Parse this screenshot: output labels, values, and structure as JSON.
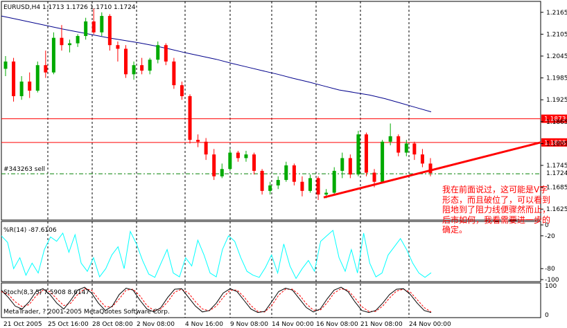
{
  "chart_data": {
    "type": "candlestick",
    "symbol_header": "EURUSD,H4  1.1713 1.1726 1.1710 1.1724",
    "price_axis": {
      "ylim": [
        1.1595,
        1.2195
      ],
      "ticks": [
        "1.2165",
        "1.2105",
        "1.2045",
        "1.1985",
        "1.1925",
        "1.1865",
        "1.1805",
        "1.1745",
        "1.1685",
        "1.1625"
      ]
    },
    "x_tick_labels": [
      "21 Oct 2005",
      "25 Oct 16:00",
      "28 Oct 08:00",
      "2 Nov 08:00",
      "4 Nov 16:00",
      "9 Nov 08:00",
      "14 Nov 00:00",
      "16 Nov 08:00",
      "21 Nov 08:00",
      "24 Nov 00:00"
    ],
    "horizontal_lines": [
      {
        "price": 1.1873,
        "label": "1.1873",
        "color": "#ff0000"
      },
      {
        "price": 1.1808,
        "label": "1.1808",
        "color": "#ff0000"
      }
    ],
    "order_line": {
      "label": "#343263 sell",
      "price": 1.1722,
      "color": "#008000"
    },
    "current_price": {
      "label": "1.1724",
      "price": 1.1724
    },
    "trendline": {
      "from_price": 1.1657,
      "to_price": 1.1808,
      "color": "#ff0000"
    },
    "moving_average": {
      "color": "#00008b",
      "values": [
        1.2155,
        1.2146,
        1.2137,
        1.2128,
        1.2119,
        1.2111,
        1.2103,
        1.2095,
        1.2088,
        1.2081,
        1.2073,
        1.2064,
        1.2054,
        1.2045,
        1.2036,
        1.2025,
        1.2015,
        1.2005,
        1.1995,
        1.1984,
        1.1974,
        1.1963,
        1.1952,
        1.1945,
        1.1938,
        1.1928,
        1.1916,
        1.1904,
        1.1892
      ]
    },
    "candles": [
      {
        "o": 1.201,
        "h": 1.2045,
        "l": 1.199,
        "c": 1.203
      },
      {
        "o": 1.203,
        "h": 1.204,
        "l": 1.192,
        "c": 1.1935
      },
      {
        "o": 1.1935,
        "h": 1.199,
        "l": 1.1925,
        "c": 1.1975
      },
      {
        "o": 1.1975,
        "h": 1.2,
        "l": 1.193,
        "c": 1.195
      },
      {
        "o": 1.195,
        "h": 1.203,
        "l": 1.1945,
        "c": 1.202
      },
      {
        "o": 1.202,
        "h": 1.206,
        "l": 1.1985,
        "c": 1.2
      },
      {
        "o": 1.2,
        "h": 1.211,
        "l": 1.1995,
        "c": 1.2095
      },
      {
        "o": 1.2095,
        "h": 1.213,
        "l": 1.206,
        "c": 1.2075
      },
      {
        "o": 1.2075,
        "h": 1.209,
        "l": 1.2055,
        "c": 1.208
      },
      {
        "o": 1.208,
        "h": 1.2105,
        "l": 1.207,
        "c": 1.21
      },
      {
        "o": 1.21,
        "h": 1.215,
        "l": 1.209,
        "c": 1.214
      },
      {
        "o": 1.214,
        "h": 1.2175,
        "l": 1.2105,
        "c": 1.211
      },
      {
        "o": 1.211,
        "h": 1.2165,
        "l": 1.21,
        "c": 1.2155
      },
      {
        "o": 1.2155,
        "h": 1.216,
        "l": 1.206,
        "c": 1.2075
      },
      {
        "o": 1.2075,
        "h": 1.2085,
        "l": 1.203,
        "c": 1.2065
      },
      {
        "o": 1.2065,
        "h": 1.2075,
        "l": 1.1985,
        "c": 1.1995
      },
      {
        "o": 1.1995,
        "h": 1.203,
        "l": 1.198,
        "c": 1.202
      },
      {
        "o": 1.202,
        "h": 1.204,
        "l": 1.1995,
        "c": 1.2005
      },
      {
        "o": 1.2005,
        "h": 1.204,
        "l": 1.1995,
        "c": 1.2035
      },
      {
        "o": 1.2035,
        "h": 1.2085,
        "l": 1.2025,
        "c": 1.2075
      },
      {
        "o": 1.2075,
        "h": 1.208,
        "l": 1.202,
        "c": 1.203
      },
      {
        "o": 1.203,
        "h": 1.204,
        "l": 1.1955,
        "c": 1.1965
      },
      {
        "o": 1.1965,
        "h": 1.1975,
        "l": 1.1925,
        "c": 1.1935
      },
      {
        "o": 1.1935,
        "h": 1.194,
        "l": 1.1805,
        "c": 1.1815
      },
      {
        "o": 1.1815,
        "h": 1.183,
        "l": 1.1795,
        "c": 1.181
      },
      {
        "o": 1.181,
        "h": 1.182,
        "l": 1.176,
        "c": 1.1775
      },
      {
        "o": 1.1775,
        "h": 1.179,
        "l": 1.1705,
        "c": 1.1715
      },
      {
        "o": 1.1715,
        "h": 1.175,
        "l": 1.171,
        "c": 1.1735
      },
      {
        "o": 1.1735,
        "h": 1.179,
        "l": 1.173,
        "c": 1.178
      },
      {
        "o": 1.178,
        "h": 1.1785,
        "l": 1.1755,
        "c": 1.1765
      },
      {
        "o": 1.1765,
        "h": 1.1785,
        "l": 1.1755,
        "c": 1.1775
      },
      {
        "o": 1.1775,
        "h": 1.178,
        "l": 1.172,
        "c": 1.173
      },
      {
        "o": 1.173,
        "h": 1.1735,
        "l": 1.1665,
        "c": 1.1675
      },
      {
        "o": 1.1675,
        "h": 1.17,
        "l": 1.1665,
        "c": 1.169
      },
      {
        "o": 1.169,
        "h": 1.1715,
        "l": 1.168,
        "c": 1.1705
      },
      {
        "o": 1.1705,
        "h": 1.1755,
        "l": 1.17,
        "c": 1.1745
      },
      {
        "o": 1.1745,
        "h": 1.175,
        "l": 1.169,
        "c": 1.17
      },
      {
        "o": 1.17,
        "h": 1.1715,
        "l": 1.166,
        "c": 1.1675
      },
      {
        "o": 1.1675,
        "h": 1.172,
        "l": 1.167,
        "c": 1.171
      },
      {
        "o": 1.171,
        "h": 1.1715,
        "l": 1.165,
        "c": 1.1665
      },
      {
        "o": 1.1665,
        "h": 1.168,
        "l": 1.1655,
        "c": 1.167
      },
      {
        "o": 1.167,
        "h": 1.174,
        "l": 1.1665,
        "c": 1.173
      },
      {
        "o": 1.173,
        "h": 1.178,
        "l": 1.171,
        "c": 1.1765
      },
      {
        "o": 1.1765,
        "h": 1.1775,
        "l": 1.171,
        "c": 1.172
      },
      {
        "o": 1.172,
        "h": 1.184,
        "l": 1.1715,
        "c": 1.183
      },
      {
        "o": 1.183,
        "h": 1.1835,
        "l": 1.1715,
        "c": 1.1725
      },
      {
        "o": 1.1725,
        "h": 1.1735,
        "l": 1.1685,
        "c": 1.17
      },
      {
        "o": 1.17,
        "h": 1.1815,
        "l": 1.1695,
        "c": 1.181
      },
      {
        "o": 1.181,
        "h": 1.186,
        "l": 1.18,
        "c": 1.1825
      },
      {
        "o": 1.1825,
        "h": 1.183,
        "l": 1.177,
        "c": 1.178
      },
      {
        "o": 1.178,
        "h": 1.1815,
        "l": 1.177,
        "c": 1.1805
      },
      {
        "o": 1.1805,
        "h": 1.181,
        "l": 1.176,
        "c": 1.1775
      },
      {
        "o": 1.1775,
        "h": 1.179,
        "l": 1.174,
        "c": 1.175
      },
      {
        "o": 1.175,
        "h": 1.1765,
        "l": 1.1715,
        "c": 1.1724
      }
    ]
  },
  "williams_r": {
    "label": "%R(14) -87.6106",
    "color": "#00ffff",
    "ticks": [
      "0",
      "-20",
      "-80",
      "-100"
    ],
    "values": [
      -20,
      -32,
      -80,
      -60,
      -92,
      -70,
      -88,
      -45,
      -22,
      -30,
      -15,
      -50,
      -18,
      -70,
      -85,
      -60,
      -95,
      -80,
      -55,
      -40,
      -80,
      -12,
      -35,
      -65,
      -90,
      -96,
      -70,
      -45,
      -88,
      -95,
      -60,
      -75,
      -28,
      -55,
      -88,
      -95,
      -45,
      -20,
      -30,
      -60,
      -85,
      -92,
      -96,
      -78,
      -55,
      -88,
      -35,
      -75,
      -98,
      -80,
      -65,
      -85,
      -30,
      -20,
      -10,
      -60,
      -85,
      -45,
      -88,
      -15,
      -70,
      -95,
      -88,
      -55,
      -40,
      -25,
      -45,
      -70,
      -88,
      -96,
      -87.6
    ]
  },
  "stochastic": {
    "label": "Stoch(8,3,5) 7.5908 8.6147",
    "main_color": "#000000",
    "signal_color": "#ff0000",
    "ticks": [
      "100",
      "0"
    ],
    "main": [
      85,
      60,
      30,
      20,
      45,
      80,
      90,
      70,
      40,
      20,
      50,
      85,
      95,
      75,
      40,
      15,
      30,
      70,
      92,
      85,
      50,
      20,
      10,
      25,
      60,
      88,
      90,
      60,
      30,
      10,
      15,
      40,
      75,
      90,
      80,
      50,
      20,
      8,
      12,
      45,
      80,
      92,
      85,
      55,
      25,
      10,
      20,
      55,
      85,
      95,
      80,
      45,
      15,
      8,
      15,
      40,
      70,
      88,
      90,
      70,
      40,
      15,
      8
    ],
    "signal": [
      80,
      70,
      45,
      28,
      35,
      65,
      85,
      80,
      55,
      32,
      40,
      70,
      90,
      85,
      55,
      28,
      28,
      55,
      85,
      88,
      65,
      32,
      15,
      20,
      45,
      78,
      88,
      75,
      45,
      20,
      14,
      30,
      60,
      85,
      85,
      62,
      32,
      12,
      10,
      32,
      68,
      88,
      88,
      68,
      38,
      16,
      16,
      42,
      75,
      90,
      85,
      58,
      28,
      12,
      12,
      30,
      58,
      82,
      88,
      78,
      52,
      25,
      10
    ]
  },
  "copyright": "MetaTrader, ? 2001-2005 MetaQuotes Software Corp.",
  "annotation": "我在前面说过，这可能是V字形态，而且破位了，可以看到阻地到了阻力线便骤然而止，后市如何，我看需要进一步的确定。"
}
